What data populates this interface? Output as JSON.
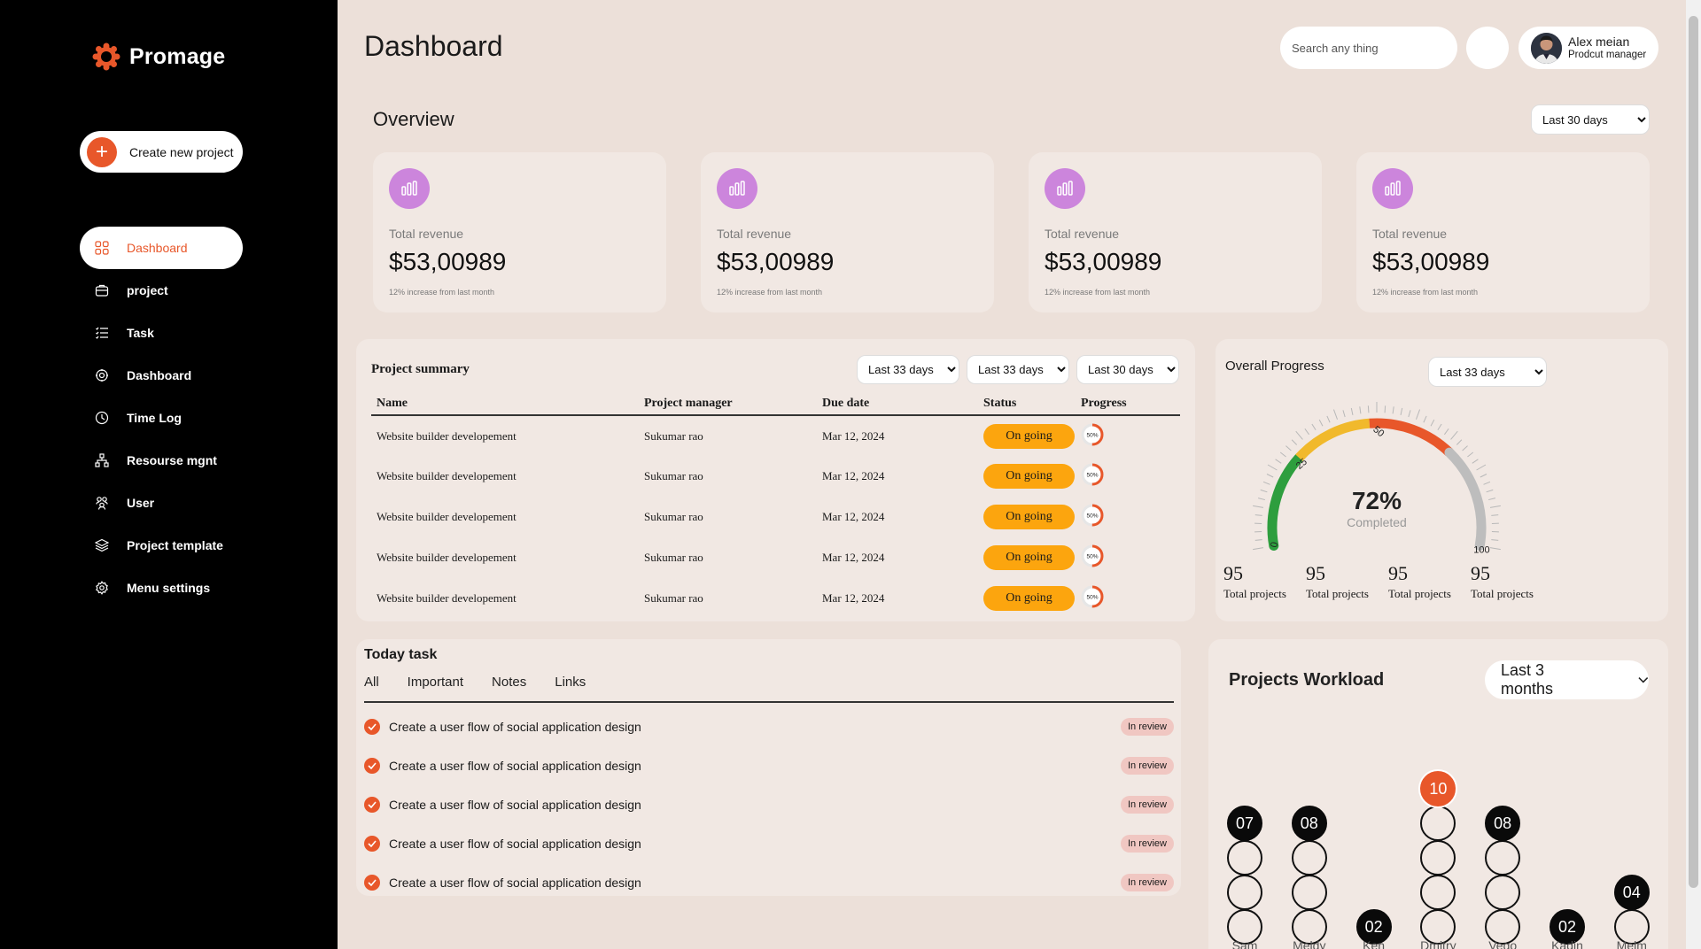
{
  "app": {
    "name": "Promage",
    "brand_color": "#e8572a"
  },
  "sidebar": {
    "create_button": "Create new project",
    "items": [
      {
        "label": "Dashboard",
        "icon": "grid-icon",
        "active": true
      },
      {
        "label": "project",
        "icon": "briefcase-icon"
      },
      {
        "label": "Task",
        "icon": "list-icon"
      },
      {
        "label": "Dashboard",
        "icon": "gear-icon"
      },
      {
        "label": "Time Log",
        "icon": "clock-icon"
      },
      {
        "label": "Resourse mgnt",
        "icon": "hierarchy-icon"
      },
      {
        "label": "User",
        "icon": "users-icon"
      },
      {
        "label": "Project template",
        "icon": "layers-icon"
      },
      {
        "label": "Menu settings",
        "icon": "settings-icon"
      }
    ]
  },
  "header": {
    "title": "Dashboard",
    "search_placeholder": "Search any thing",
    "user": {
      "name": "Alex meian",
      "role": "Prodcut manager"
    }
  },
  "overview": {
    "title": "Overview",
    "range": "Last 30 days",
    "cards": [
      {
        "label": "Total revenue",
        "value": "$53,00989",
        "note": "12% increase from last month"
      },
      {
        "label": "Total revenue",
        "value": "$53,00989",
        "note": "12% increase from last month"
      },
      {
        "label": "Total revenue",
        "value": "$53,00989",
        "note": "12% increase from last month"
      },
      {
        "label": "Total revenue",
        "value": "$53,00989",
        "note": "12% increase from last month"
      }
    ]
  },
  "project_summary": {
    "title": "Project summary",
    "filters": [
      "Last 33 days",
      "Last 33 days",
      "Last 30 days"
    ],
    "columns": [
      "Name",
      "Project manager",
      "Due date",
      "Status",
      "Progress"
    ],
    "rows": [
      {
        "name": "Website builder developement",
        "manager": "Sukumar rao",
        "due": "Mar 12, 2024",
        "status": "On going",
        "progress": "50%",
        "progress_value": 0.5
      },
      {
        "name": "Website builder developement",
        "manager": "Sukumar rao",
        "due": "Mar 12, 2024",
        "status": "On going",
        "progress": "50%",
        "progress_value": 0.5
      },
      {
        "name": "Website builder developement",
        "manager": "Sukumar rao",
        "due": "Mar 12, 2024",
        "status": "On going",
        "progress": "50%",
        "progress_value": 0.5
      },
      {
        "name": "Website builder developement",
        "manager": "Sukumar rao",
        "due": "Mar 12, 2024",
        "status": "On going",
        "progress": "50%",
        "progress_value": 0.5
      },
      {
        "name": "Website builder developement",
        "manager": "Sukumar rao",
        "due": "Mar 12, 2024",
        "status": "On going",
        "progress": "50%",
        "progress_value": 0.5
      }
    ]
  },
  "overall_progress": {
    "title": "Overall Progress",
    "range": "Last 33 days",
    "percent": "72%",
    "percent_value": 72,
    "label": "Completed",
    "ticks": [
      "0",
      "25",
      "50",
      "100"
    ],
    "stats": [
      {
        "value": "95",
        "label": "Total projects"
      },
      {
        "value": "95",
        "label": "Total projects"
      },
      {
        "value": "95",
        "label": "Total projects"
      },
      {
        "value": "95",
        "label": "Total projects"
      }
    ]
  },
  "today_task": {
    "title": "Today task",
    "tabs": [
      "All",
      "Important",
      "Notes",
      "Links"
    ],
    "tasks": [
      {
        "text": "Create a user flow of social application design",
        "status": "In review"
      },
      {
        "text": "Create a user flow of social application design",
        "status": "In review"
      },
      {
        "text": "Create a user flow of social application design",
        "status": "In review"
      },
      {
        "text": "Create a user flow of social application design",
        "status": "In review"
      },
      {
        "text": "Create a user flow of social application design",
        "status": "In review"
      }
    ]
  },
  "workload": {
    "title": "Projects Workload",
    "range": "Last 3 months",
    "people": [
      {
        "name": "Sam",
        "count": 7,
        "label": "07"
      },
      {
        "name": "Meldy",
        "count": 8,
        "label": "08"
      },
      {
        "name": "Ken",
        "count": 2,
        "label": "02"
      },
      {
        "name": "Dmitry",
        "count": 10,
        "label": "10",
        "highlight": true
      },
      {
        "name": "Vego",
        "count": 8,
        "label": "08"
      },
      {
        "name": "Kadin",
        "count": 2,
        "label": "02"
      },
      {
        "name": "Melm",
        "count": 4,
        "label": "04"
      }
    ]
  }
}
